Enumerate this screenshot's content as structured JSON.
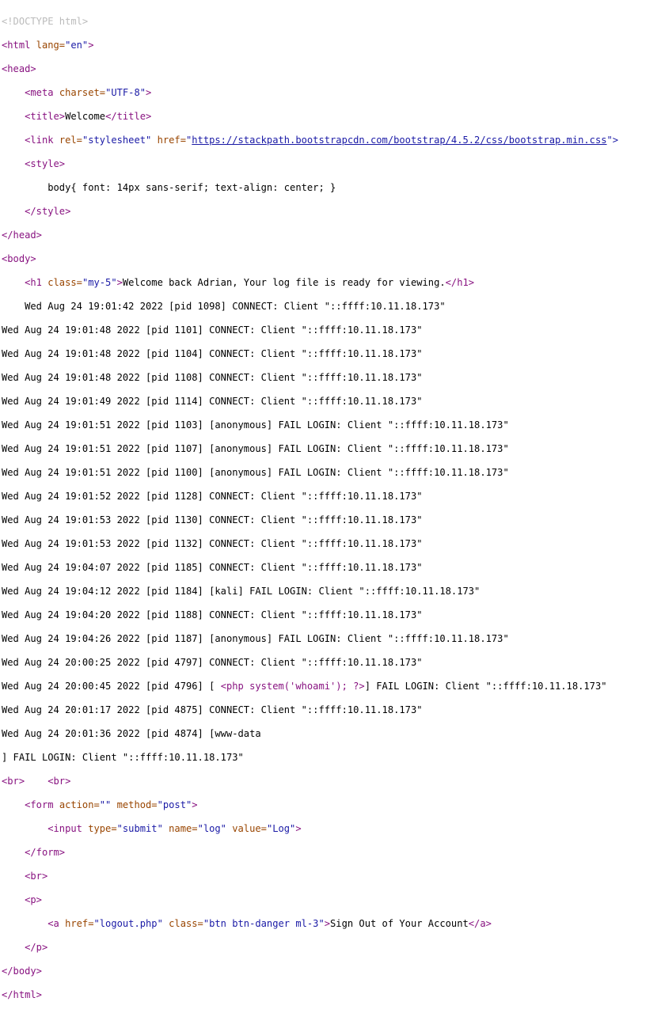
{
  "doctype": "<!DOCTYPE html>",
  "html_open": {
    "tag": "<html",
    "attr": "lang=",
    "val": "\"en\"",
    "close": ">"
  },
  "head_open": "<head>",
  "meta": {
    "tag": "<meta",
    "attr": "charset=",
    "val": "\"UTF-8\"",
    "close": ">"
  },
  "title": {
    "open": "<title>",
    "text": "Welcome",
    "close": "</title>"
  },
  "link": {
    "tag": "<link",
    "attr_rel": "rel=",
    "val_rel": "\"stylesheet\"",
    "attr_href": "href=",
    "quote": "\"",
    "url": "https://stackpath.bootstrapcdn.com/bootstrap/4.5.2/css/bootstrap.min.css",
    "tail": "\">"
  },
  "style_open": "<style>",
  "style_text": "body{ font: 14px sans-serif; text-align: center; }",
  "style_close": "</style>",
  "head_close": "</head>",
  "body_open": "<body>",
  "h1": {
    "tag": "<h1",
    "attr": "class=",
    "val": "\"my-5\"",
    "gt": ">",
    "text": "Welcome back Adrian, Your log file is ready for viewing.",
    "close": "</h1>"
  },
  "log_lines": [
    "    Wed Aug 24 19:01:42 2022 [pid 1098] CONNECT: Client \"::ffff:10.11.18.173\"",
    "Wed Aug 24 19:01:48 2022 [pid 1101] CONNECT: Client \"::ffff:10.11.18.173\"",
    "Wed Aug 24 19:01:48 2022 [pid 1104] CONNECT: Client \"::ffff:10.11.18.173\"",
    "Wed Aug 24 19:01:48 2022 [pid 1108] CONNECT: Client \"::ffff:10.11.18.173\"",
    "Wed Aug 24 19:01:49 2022 [pid 1114] CONNECT: Client \"::ffff:10.11.18.173\"",
    "Wed Aug 24 19:01:51 2022 [pid 1103] [anonymous] FAIL LOGIN: Client \"::ffff:10.11.18.173\"",
    "Wed Aug 24 19:01:51 2022 [pid 1107] [anonymous] FAIL LOGIN: Client \"::ffff:10.11.18.173\"",
    "Wed Aug 24 19:01:51 2022 [pid 1100] [anonymous] FAIL LOGIN: Client \"::ffff:10.11.18.173\"",
    "Wed Aug 24 19:01:52 2022 [pid 1128] CONNECT: Client \"::ffff:10.11.18.173\"",
    "Wed Aug 24 19:01:53 2022 [pid 1130] CONNECT: Client \"::ffff:10.11.18.173\"",
    "Wed Aug 24 19:01:53 2022 [pid 1132] CONNECT: Client \"::ffff:10.11.18.173\"",
    "Wed Aug 24 19:04:07 2022 [pid 1185] CONNECT: Client \"::ffff:10.11.18.173\"",
    "Wed Aug 24 19:04:12 2022 [pid 1184] [kali] FAIL LOGIN: Client \"::ffff:10.11.18.173\"",
    "Wed Aug 24 19:04:20 2022 [pid 1188] CONNECT: Client \"::ffff:10.11.18.173\"",
    "Wed Aug 24 19:04:26 2022 [pid 1187] [anonymous] FAIL LOGIN: Client \"::ffff:10.11.18.173\"",
    "Wed Aug 24 20:00:25 2022 [pid 4797] CONNECT: Client \"::ffff:10.11.18.173\""
  ],
  "php_line": {
    "prefix": "Wed Aug 24 20:00:45 2022 [pid 4796] [ ",
    "php": "<php system('whoami'); ?>",
    "suffix": "] FAIL LOGIN: Client \"::ffff:10.11.18.173\""
  },
  "log_lines_2": [
    "Wed Aug 24 20:01:17 2022 [pid 4875] CONNECT: Client \"::ffff:10.11.18.173\"",
    "Wed Aug 24 20:01:36 2022 [pid 4874] [www-data",
    "] FAIL LOGIN: Client \"::ffff:10.11.18.173\""
  ],
  "br_pair": {
    "br1": "<br>",
    "br2": "<br>"
  },
  "form": {
    "tag": "<form",
    "attr_action": "action=",
    "val_action": "\"\"",
    "attr_method": "method=",
    "val_method": "\"post\"",
    "gt": ">"
  },
  "input": {
    "tag": "<input",
    "attr_type": "type=",
    "val_type": "\"submit\"",
    "attr_name": "name=",
    "val_name": "\"log\"",
    "attr_value": "value=",
    "val_value": "\"Log\"",
    "gt": ">"
  },
  "form_close": "</form>",
  "br_single": "<br>",
  "p_open": "<p>",
  "anchor": {
    "tag": "<a",
    "attr_href": "href=",
    "val_href": "\"logout.php\"",
    "attr_class": "class=",
    "val_class": "\"btn btn-danger ml-3\"",
    "gt": ">",
    "text": "Sign Out of Your Account",
    "close": "</a>"
  },
  "p_close": "</p>",
  "body_close": "</body>",
  "html_close": "</html>",
  "colors": {
    "tag": "#881280",
    "attribute": "#994500",
    "value": "#1a1aa6",
    "doctype": "#bbbbbb",
    "text": "#000000"
  }
}
